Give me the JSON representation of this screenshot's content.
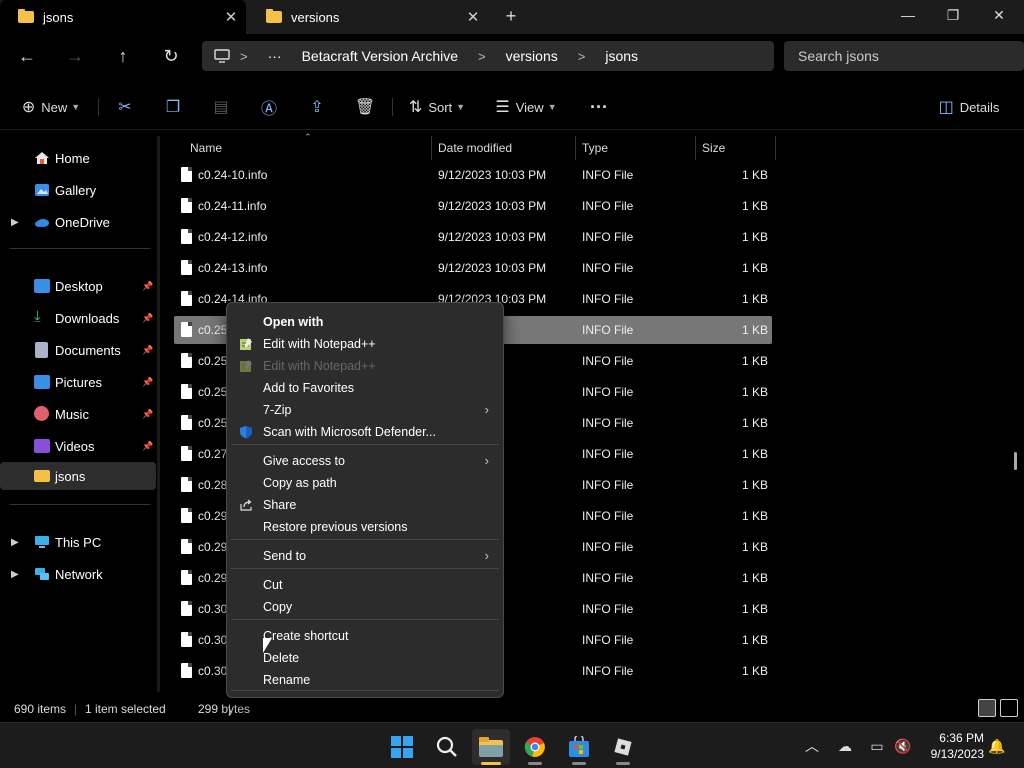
{
  "tabs": [
    {
      "label": "jsons",
      "close": "✕"
    },
    {
      "label": "versions",
      "close": "✕"
    }
  ],
  "new_tab": "+",
  "window": {
    "minimize": "—",
    "maximize": "❐",
    "close": "✕"
  },
  "nav": {
    "back": "←",
    "forward": "→",
    "up": "↑",
    "refresh": "↻"
  },
  "address": {
    "ellipsis": "···",
    "separator": ">",
    "segments": [
      "Betacraft Version Archive",
      "versions",
      "jsons"
    ]
  },
  "search": {
    "placeholder": "Search jsons"
  },
  "toolbar": {
    "new_label": "New",
    "sort_label": "Sort",
    "view_label": "View",
    "more": "···",
    "details_label": "Details"
  },
  "sidebar": {
    "items": [
      {
        "label": "Home"
      },
      {
        "label": "Gallery"
      },
      {
        "label": "OneDrive"
      },
      {
        "label": "Desktop"
      },
      {
        "label": "Downloads"
      },
      {
        "label": "Documents"
      },
      {
        "label": "Pictures"
      },
      {
        "label": "Music"
      },
      {
        "label": "Videos"
      },
      {
        "label": "jsons"
      },
      {
        "label": "This PC"
      },
      {
        "label": "Network"
      }
    ]
  },
  "columns": {
    "name": "Name",
    "date": "Date modified",
    "type": "Type",
    "size": "Size"
  },
  "files": [
    {
      "name": "c0.24-10.info",
      "date": "9/12/2023 10:03 PM",
      "type": "INFO File",
      "size": "1 KB"
    },
    {
      "name": "c0.24-11.info",
      "date": "9/12/2023 10:03 PM",
      "type": "INFO File",
      "size": "1 KB"
    },
    {
      "name": "c0.24-12.info",
      "date": "9/12/2023 10:03 PM",
      "type": "INFO File",
      "size": "1 KB"
    },
    {
      "name": "c0.24-13.info",
      "date": "9/12/2023 10:03 PM",
      "type": "INFO File",
      "size": "1 KB"
    },
    {
      "name": "c0.24-14.info",
      "date": "9/12/2023 10:03 PM",
      "type": "INFO File",
      "size": "1 KB"
    },
    {
      "name": "c0.25",
      "date": "03 PM",
      "type": "INFO File",
      "size": "1 KB"
    },
    {
      "name": "c0.25",
      "date": "03 PM",
      "type": "INFO File",
      "size": "1 KB"
    },
    {
      "name": "c0.25",
      "date": "03 PM",
      "type": "INFO File",
      "size": "1 KB"
    },
    {
      "name": "c0.25",
      "date": "03 PM",
      "type": "INFO File",
      "size": "1 KB"
    },
    {
      "name": "c0.27",
      "date": "03 PM",
      "type": "INFO File",
      "size": "1 KB"
    },
    {
      "name": "c0.28",
      "date": "03 PM",
      "type": "INFO File",
      "size": "1 KB"
    },
    {
      "name": "c0.29",
      "date": "03 PM",
      "type": "INFO File",
      "size": "1 KB"
    },
    {
      "name": "c0.29",
      "date": "03 PM",
      "type": "INFO File",
      "size": "1 KB"
    },
    {
      "name": "c0.29",
      "date": "03 PM",
      "type": "INFO File",
      "size": "1 KB"
    },
    {
      "name": "c0.30",
      "date": "03 PM",
      "type": "INFO File",
      "size": "1 KB"
    },
    {
      "name": "c0.30",
      "date": "03 PM",
      "type": "INFO File",
      "size": "1 KB"
    },
    {
      "name": "c0.30",
      "date": "03 PM",
      "type": "INFO File",
      "size": "1 KB"
    }
  ],
  "selected_row_index": 5,
  "context_menu": {
    "items": [
      {
        "label": "Open with",
        "bold": true
      },
      {
        "label": "Edit with Notepad++",
        "icon": "notepad-icon"
      },
      {
        "label": "Edit with Notepad++",
        "icon": "notepad-icon",
        "disabled": true
      },
      {
        "label": "Add to Favorites"
      },
      {
        "label": "7-Zip",
        "submenu": true
      },
      {
        "label": "Scan with Microsoft Defender...",
        "icon": "defender-shield-icon"
      },
      {
        "label": "Give access to",
        "submenu": true
      },
      {
        "label": "Copy as path"
      },
      {
        "label": "Share",
        "icon": "share-icon"
      },
      {
        "label": "Restore previous versions"
      },
      {
        "label": "Send to",
        "submenu": true
      },
      {
        "label": "Cut"
      },
      {
        "label": "Copy"
      },
      {
        "label": "Create shortcut"
      },
      {
        "label": "Delete"
      },
      {
        "label": "Rename"
      }
    ],
    "submenu_arrow": "›"
  },
  "status": {
    "item_count": "690 items",
    "selection": "1 item selected",
    "size": "299 bytes"
  },
  "taskbar": {
    "clock_time": "6:36 PM",
    "clock_date": "9/13/2023",
    "apps": [
      "start-icon",
      "search-icon",
      "file-explorer-icon",
      "chrome-icon",
      "microsoft-store-icon",
      "roblox-icon"
    ]
  },
  "colors": {
    "accent": "#f4c046",
    "selection": "#777777",
    "menu_bg": "#2c2c2c"
  }
}
